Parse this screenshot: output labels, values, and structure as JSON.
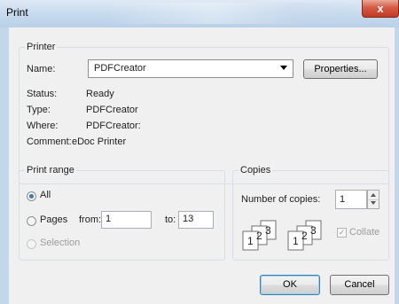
{
  "window": {
    "title": "Print",
    "close_glyph": "x"
  },
  "printer": {
    "legend": "Printer",
    "name_label": "Name:",
    "name_value": "PDFCreator",
    "properties_label": "Properties...",
    "status_label": "Status:",
    "status_value": "Ready",
    "type_label": "Type:",
    "type_value": "PDFCreator",
    "where_label": "Where:",
    "where_value": "PDFCreator:",
    "comment_label": "Comment:",
    "comment_value": "eDoc Printer"
  },
  "print_range": {
    "legend": "Print range",
    "all_label": "All",
    "pages_label": "Pages",
    "from_label": "from:",
    "from_value": "1",
    "to_label": "to:",
    "to_value": "13",
    "selection_label": "Selection"
  },
  "copies": {
    "legend": "Copies",
    "number_label": "Number of copies:",
    "number_value": "1",
    "collate_label": "Collate",
    "collate_checked": true,
    "collate_digits": [
      "1",
      "2",
      "3"
    ]
  },
  "buttons": {
    "ok": "OK",
    "cancel": "Cancel"
  },
  "colors": {
    "title_bar": "#c9dcee",
    "close_button": "#c8432b",
    "dialog_bg": "#f0f0f0",
    "accent": "#3a79b8"
  }
}
